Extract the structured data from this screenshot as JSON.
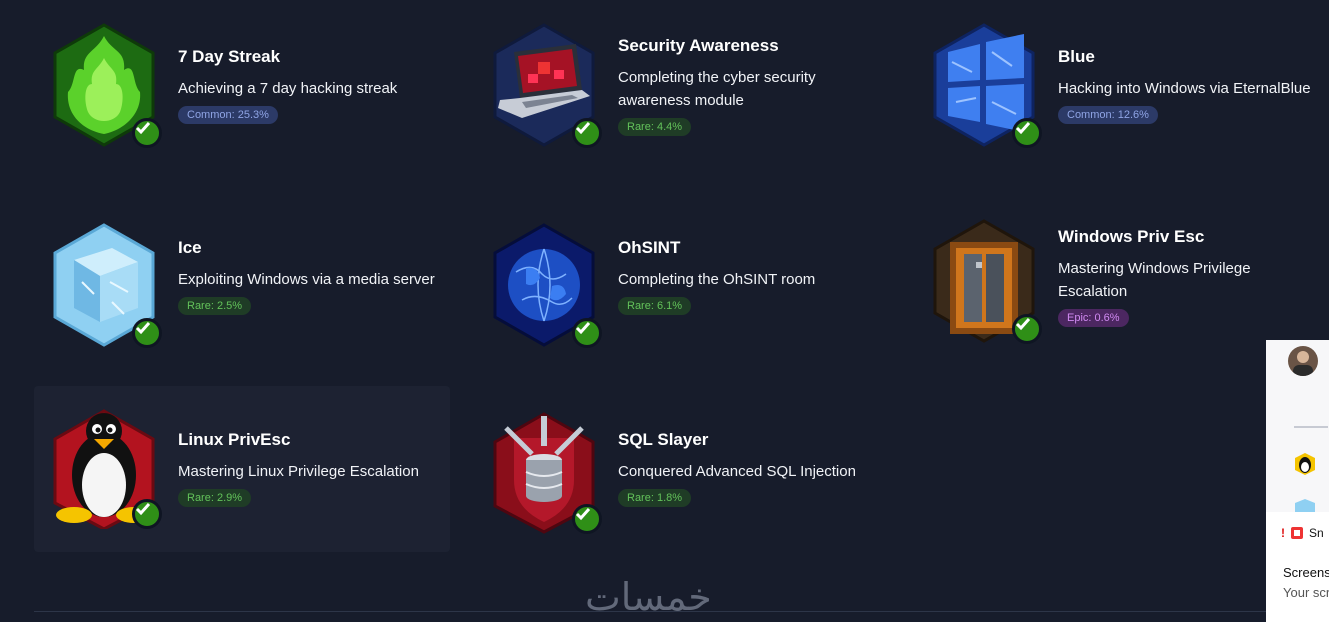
{
  "badges": [
    {
      "title": "7 Day Streak",
      "desc": "Achieving a 7 day hacking streak",
      "rarity": "Common: 25.3%",
      "tier": "common",
      "icon": "fire-badge-icon"
    },
    {
      "title": "Security Awareness",
      "desc": "Completing the cyber security awareness module",
      "rarity": "Rare: 4.4%",
      "tier": "rare",
      "icon": "laptop-badge-icon"
    },
    {
      "title": "Blue",
      "desc": "Hacking into Windows via EternalBlue",
      "rarity": "Common: 12.6%",
      "tier": "common",
      "icon": "windows-badge-icon"
    },
    {
      "title": "Ice",
      "desc": "Exploiting Windows via a media server",
      "rarity": "Rare: 2.5%",
      "tier": "rare",
      "icon": "ice-cube-badge-icon"
    },
    {
      "title": "OhSINT",
      "desc": "Completing the OhSINT room",
      "rarity": "Rare: 6.1%",
      "tier": "rare",
      "icon": "globe-badge-icon"
    },
    {
      "title": "Windows Priv Esc",
      "desc": "Mastering Windows Privilege Escalation",
      "rarity": "Epic: 0.6%",
      "tier": "epic",
      "icon": "elevator-badge-icon"
    },
    {
      "title": "Linux PrivEsc",
      "desc": "Mastering Linux Privilege Escalation",
      "rarity": "Rare: 2.9%",
      "tier": "rare",
      "icon": "penguin-badge-icon"
    },
    {
      "title": "SQL Slayer",
      "desc": "Conquered Advanced SQL Injection",
      "rarity": "Rare: 1.8%",
      "tier": "rare",
      "icon": "database-shield-badge-icon"
    }
  ],
  "watermark": "خمسات",
  "toast": {
    "head": "Sn",
    "title": "Screens",
    "sub": "Your scr"
  },
  "colors": {
    "background": "#171c2b",
    "check": "#2f8f17",
    "common": "#8fa4e5",
    "rare": "#63c25a",
    "epic": "#d18af2"
  }
}
